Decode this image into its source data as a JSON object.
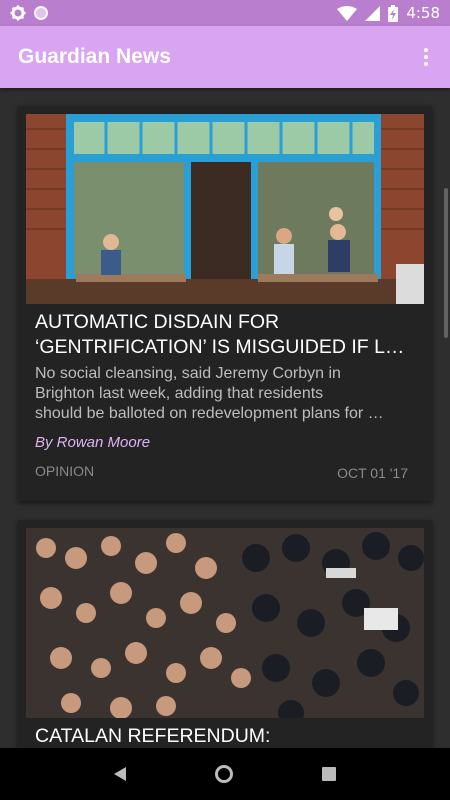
{
  "status_bar": {
    "time": "4:58",
    "icons": [
      "settings-icon",
      "circle-icon",
      "wifi-icon",
      "signal-icon",
      "battery-charging-icon"
    ]
  },
  "app_bar": {
    "title": "Guardian News",
    "menu_icon": "overflow-menu-icon"
  },
  "articles": [
    {
      "title_line1": "AUTOMATIC DISDAIN FOR",
      "title_line2": "‘GENTRIFICATION’ IS MISGUIDED IF L…",
      "trail_line1": "No social cleansing, said Jeremy Corbyn in",
      "trail_line2": "Brighton last week, adding that residents",
      "trail_line3": "should be balloted on redevelopment plans for …",
      "byline": "By Rowan Moore",
      "section": "OPINION",
      "date": "OCT 01 '17",
      "image": "cafe-photo"
    },
    {
      "title_line1": "CATALAN REFERENDUM:",
      "image": "crowd-police-photo"
    }
  ],
  "nav_bar": {
    "icons": [
      "back-icon",
      "home-icon",
      "recents-icon"
    ]
  },
  "colors": {
    "status_bar": "#b97fce",
    "app_bar": "#d9a4f2",
    "card_bg": "#232323",
    "byline": "#e0b3f7"
  }
}
